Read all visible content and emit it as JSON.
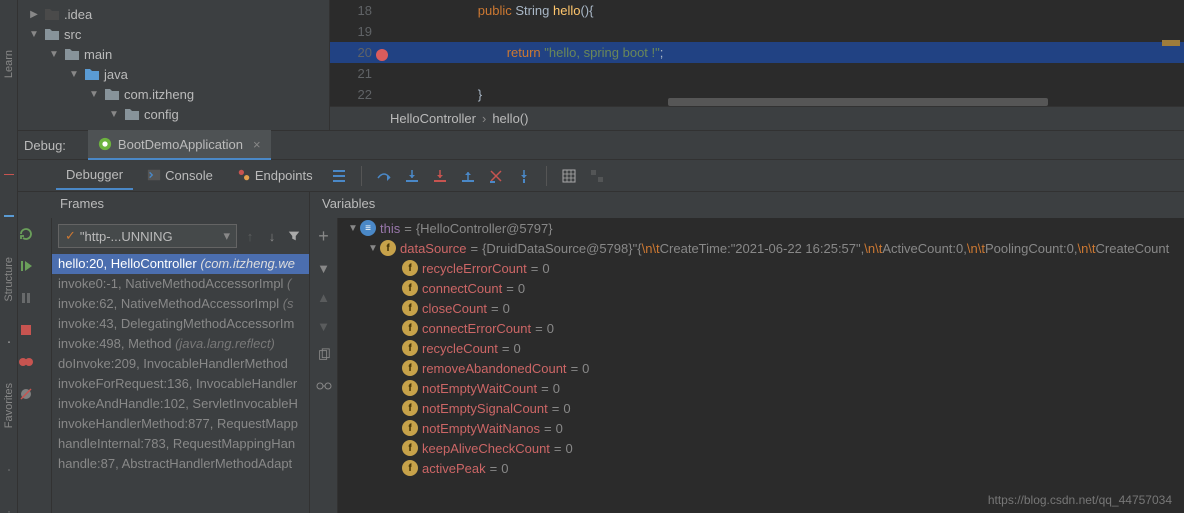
{
  "project_tree": {
    "items": [
      {
        "indent": 28,
        "arrow": "▶",
        "icon": "dark",
        "label": ".idea"
      },
      {
        "indent": 28,
        "arrow": "▼",
        "icon": "gray",
        "label": "src"
      },
      {
        "indent": 48,
        "arrow": "▼",
        "icon": "gray",
        "label": "main"
      },
      {
        "indent": 68,
        "arrow": "▼",
        "icon": "blue",
        "label": "java"
      },
      {
        "indent": 88,
        "arrow": "▼",
        "icon": "gray",
        "label": "com.itzheng"
      },
      {
        "indent": 108,
        "arrow": "▼",
        "icon": "gray",
        "label": "config"
      }
    ]
  },
  "editor": {
    "lines": [
      {
        "num": "18",
        "html": "<span class='kw-public'>public</span> <span class='type'>String</span> <span class='method'>hello</span><span class='brace'>(){</span>",
        "indent": 4
      },
      {
        "num": "19",
        "html": "",
        "indent": 0
      },
      {
        "num": "20",
        "html": "<span class='kw-return'>return</span> <span class='string'>\"hello, spring boot !\"</span><span class='brace'>;</span>",
        "indent": 6,
        "hl": true,
        "bp": true
      },
      {
        "num": "21",
        "html": "",
        "indent": 0
      },
      {
        "num": "22",
        "html": "<span class='brace'>}</span>",
        "indent": 4
      }
    ],
    "breadcrumb": {
      "a": "HelloController",
      "b": "hello()"
    }
  },
  "debug_tab": {
    "title": "Debug:",
    "name": "BootDemoApplication"
  },
  "toolbar": {
    "debugger": "Debugger",
    "console": "Console",
    "endpoints": "Endpoints"
  },
  "frames": {
    "header": "Frames",
    "thread": "\"http-...UNNING",
    "items": [
      {
        "loc": "hello:20, HelloController",
        "pkg": " (com.itzheng.we",
        "sel": true
      },
      {
        "loc": "invoke0:-1, NativeMethodAccessorImpl",
        "pkg": " ("
      },
      {
        "loc": "invoke:62, NativeMethodAccessorImpl",
        "pkg": " (s"
      },
      {
        "loc": "invoke:43, DelegatingMethodAccessorIm",
        "pkg": ""
      },
      {
        "loc": "invoke:498, Method",
        "pkg": " (java.lang.reflect)"
      },
      {
        "loc": "doInvoke:209, InvocableHandlerMethod",
        "pkg": ""
      },
      {
        "loc": "invokeForRequest:136, InvocableHandler",
        "pkg": ""
      },
      {
        "loc": "invokeAndHandle:102, ServletInvocableH",
        "pkg": ""
      },
      {
        "loc": "invokeHandlerMethod:877, RequestMapp",
        "pkg": ""
      },
      {
        "loc": "handleInternal:783, RequestMappingHan",
        "pkg": ""
      },
      {
        "loc": "handle:87, AbstractHandlerMethodAdapt",
        "pkg": ""
      }
    ]
  },
  "variables": {
    "header": "Variables",
    "this_label": "this",
    "this_val": "{HelloController@5797}",
    "ds_label": "dataSource",
    "ds_obj": "{DruidDataSource@5798}",
    "ds_str_pre": " \"{",
    "ds_esc1": "\\n\\t",
    "ds_p1": "CreateTime:\"2021-06-22 16:25:57\",",
    "ds_esc2": "\\n\\t",
    "ds_p2": "ActiveCount:0,",
    "ds_esc3": "\\n\\t",
    "ds_p3": "PoolingCount:0,",
    "ds_esc4": "\\n\\t",
    "ds_p4": "CreateCount",
    "fields": [
      {
        "name": "recycleErrorCount",
        "val": "0"
      },
      {
        "name": "connectCount",
        "val": "0"
      },
      {
        "name": "closeCount",
        "val": "0"
      },
      {
        "name": "connectErrorCount",
        "val": "0"
      },
      {
        "name": "recycleCount",
        "val": "0"
      },
      {
        "name": "removeAbandonedCount",
        "val": "0"
      },
      {
        "name": "notEmptyWaitCount",
        "val": "0"
      },
      {
        "name": "notEmptySignalCount",
        "val": "0"
      },
      {
        "name": "notEmptyWaitNanos",
        "val": "0"
      },
      {
        "name": "keepAliveCheckCount",
        "val": "0"
      },
      {
        "name": "activePeak",
        "val": "0"
      }
    ]
  },
  "watermark": "https://blog.csdn.net/qq_44757034"
}
